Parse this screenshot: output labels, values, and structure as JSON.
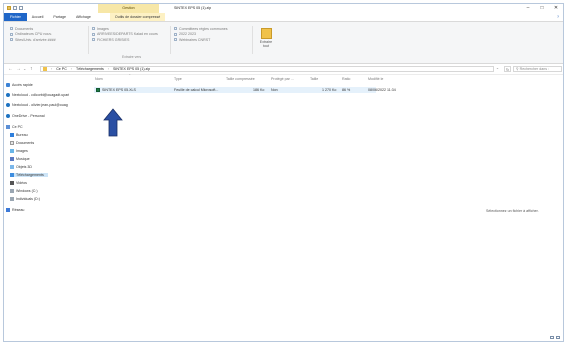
{
  "window": {
    "title": "SINTEX EPS 05 (1).zip",
    "context_tab": "Gestion",
    "controls": {
      "minimize": "–",
      "maximize": "□",
      "close": "✕"
    }
  },
  "ribbon": {
    "tabs": {
      "fichier": "Fichier",
      "accueil": "Accueil",
      "partage": "Partage",
      "affichage": "Affichage",
      "outils": "Outils de dossier compressé"
    },
    "help": "?",
    "destinations_left": [
      "Documents",
      "Ordinateurs CPU nouv.",
      "Sites/Univ. d'arrivée ####"
    ],
    "destinations_mid": [
      "Images",
      "ARRIVEES/DEPARTS Kalad en cours",
      "FICHIERS GRISIES"
    ],
    "destinations_right": [
      "Committees règles communes",
      "2022 2023",
      "Webinaires CNRST"
    ],
    "extract_all_label": "Extraire tout",
    "group_label": "Extraire vers"
  },
  "address": {
    "back": "←",
    "forward": "→",
    "recent": "⌄",
    "up": "↑",
    "crumbs": [
      "Ce PC",
      "Téléchargements",
      "SINTEX EPS 05 (1).zip"
    ],
    "chevron": "›",
    "dropdown": "⌄",
    "refresh": "↻",
    "search_icon": "⚲",
    "search_placeholder": "Rechercher dans :"
  },
  "nav": {
    "quick_access": "Accès rapide",
    "nextcloud1": "Nextcloud - cdlcorbi@ouagadt.upari",
    "nextcloud2": "Nextcloud - olivier.jean-paul@ouag",
    "onedrive": "OneDrive - Personal",
    "this_pc": "Ce PC",
    "bureau": "Bureau",
    "documents": "Documents",
    "images": "Images",
    "musique": "Musique",
    "objets3d": "Objets 3D",
    "telechargements": "Téléchargements",
    "videos": "Vidéos",
    "windows": "Windows (C:)",
    "individuals": "Individuals (D:)",
    "reseau": "Réseau"
  },
  "columns": {
    "nom": "Nom",
    "type": "Type",
    "taille_compressee": "Taille compressée",
    "protege": "Protégé par ...",
    "taille": "Taille",
    "ratio": "Ratio",
    "modifie": "Modifié le",
    "sort_indicator": "^"
  },
  "files": [
    {
      "name": "SINTEX EPS 05.XLS",
      "type": "Feuille de calcul Microsoft...",
      "compressed": "186 Ko",
      "protected": "Non",
      "size": "1 270 Ko",
      "ratio": "86 %",
      "modified": "08/06/2022 11:34"
    }
  ],
  "detail_message": "Sélectionnez un fichier à afficher.",
  "annotation_color": "#2a4fa3"
}
